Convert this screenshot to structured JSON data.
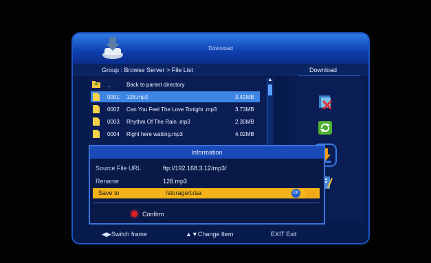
{
  "window": {
    "title": "Download"
  },
  "path": "Group : Browse Server > File List",
  "side_panel": {
    "heading": "Download"
  },
  "file_list": [
    {
      "num": "..",
      "name": "Back to parent directory",
      "size": "",
      "selected": false,
      "icon": "folder-up-icon"
    },
    {
      "num": "0001",
      "name": "128.mp3",
      "size": "3.42MB",
      "selected": true,
      "icon": "file-icon"
    },
    {
      "num": "0002",
      "name": "Can You Feel The Love Tonight .mp3",
      "size": "3.73MB",
      "selected": false,
      "icon": "file-icon"
    },
    {
      "num": "0003",
      "name": "Rhythm Of The Rain .mp3",
      "size": "2.30MB",
      "selected": false,
      "icon": "file-icon"
    },
    {
      "num": "0004",
      "name": "Right here waiting.mp3",
      "size": "4.02MB",
      "selected": false,
      "icon": "file-icon"
    }
  ],
  "dialog": {
    "title": "Information",
    "source_label": "Source File URL",
    "source_value": "ftp://192.168.3.12/mp3/",
    "rename_label": "Rename",
    "rename_value": "128.mp3",
    "save_label": "Save to",
    "save_value": "/storage/c/aa",
    "ok_label": "OK",
    "confirm_label": "Confirm"
  },
  "footer": {
    "switch_frame": "Switch frame",
    "change_item": "Change Item",
    "exit": "EXIT Exit"
  }
}
